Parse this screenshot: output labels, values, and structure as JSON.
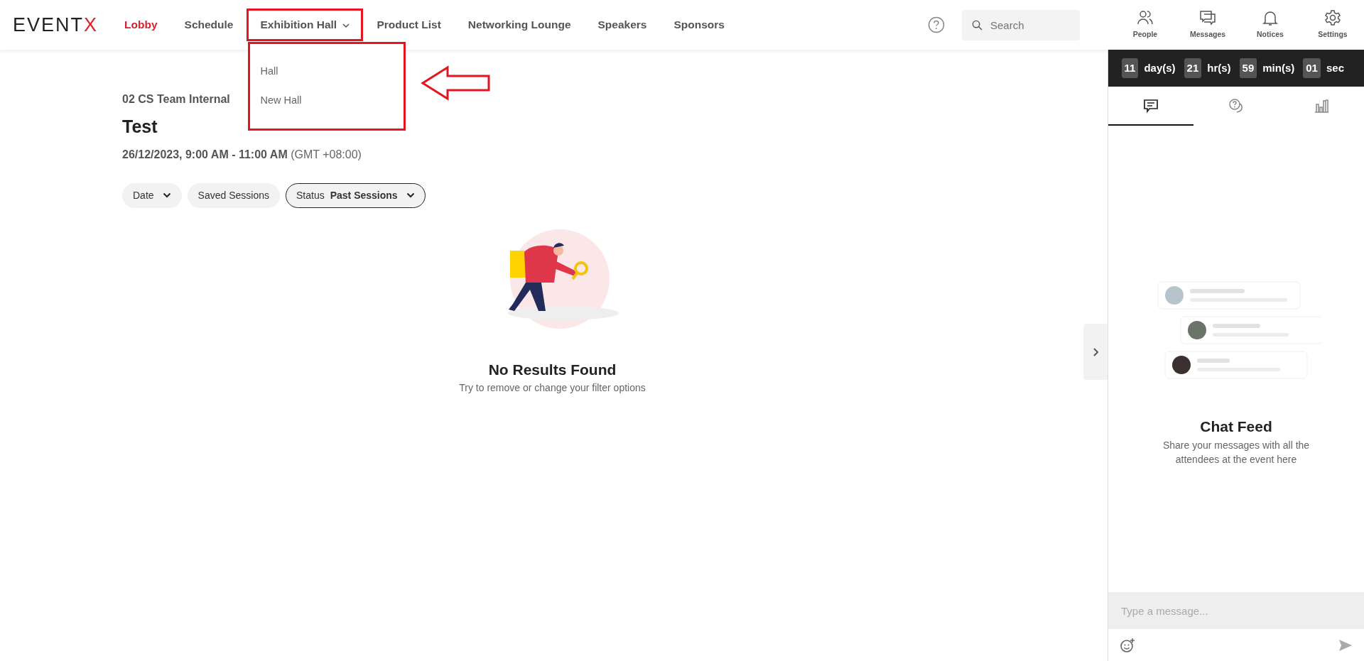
{
  "nav": {
    "logo": "EVENTX",
    "items": [
      {
        "label": "Lobby",
        "selected": true,
        "highlighted": false
      },
      {
        "label": "Schedule",
        "selected": false,
        "highlighted": false
      },
      {
        "label": "Exhibition Hall",
        "selected": false,
        "highlighted": true,
        "menu": [
          "Hall",
          "New Hall"
        ]
      },
      {
        "label": "Product List",
        "selected": false,
        "highlighted": false
      },
      {
        "label": "Networking Lounge",
        "selected": false,
        "highlighted": false
      },
      {
        "label": "Speakers",
        "selected": false,
        "highlighted": false
      },
      {
        "label": "Sponsors",
        "selected": false,
        "highlighted": false
      }
    ],
    "search": {
      "placeholder": "Search"
    },
    "tools": [
      {
        "kind": "people",
        "label": "People"
      },
      {
        "kind": "messages",
        "label": "Messages"
      },
      {
        "kind": "notices",
        "label": "Notices"
      },
      {
        "kind": "settings",
        "label": "Settings"
      }
    ]
  },
  "session": {
    "event": "02 CS Team Internal",
    "title": "Test",
    "time": "**26/12/2023, 9:00 AM - 11:00 AM** (GMT +08:00)"
  },
  "filters": [
    {
      "kind": "dropdown",
      "label": "Date",
      "selected": false
    },
    {
      "kind": "toggle",
      "label": "Saved Sessions",
      "selected": false
    },
    {
      "kind": "dropdown",
      "label": "Status",
      "value": "Past Sessions",
      "selected": true
    }
  ],
  "empty_state": {
    "title": "No Results Found",
    "subtitle": "Try to remove or change your filter options"
  },
  "countdown": [
    {
      "value": "11",
      "unit": "day(s)"
    },
    {
      "value": "21",
      "unit": "hr(s)"
    },
    {
      "value": "59",
      "unit": "min(s)"
    },
    {
      "value": "01",
      "unit": "sec"
    }
  ],
  "chat_tabs": [
    {
      "kind": "chat",
      "selected": true
    },
    {
      "kind": "questions",
      "selected": false
    },
    {
      "kind": "polls",
      "selected": false
    }
  ],
  "chat": {
    "title": "Chat Feed",
    "subtitle": "Share your messages with all the attendees at the event here",
    "placeholder": "Type a message..."
  }
}
